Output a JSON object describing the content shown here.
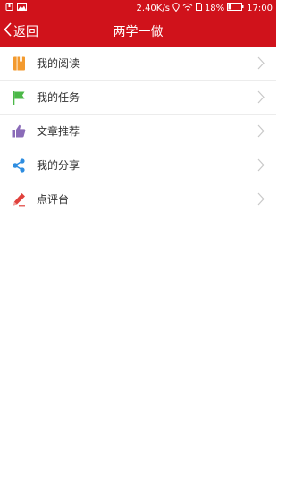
{
  "status_bar": {
    "net_speed": "2.40K/s",
    "battery_percent": "18%",
    "time": "17:00",
    "icons": [
      "notification-icon",
      "image-icon",
      "location-icon",
      "wifi-icon",
      "sim-icon",
      "battery-icon"
    ]
  },
  "nav": {
    "back_label": "返回",
    "title": "两学一做",
    "color": "#d0121b"
  },
  "menu": {
    "items": [
      {
        "label": "我的阅读",
        "icon": "book-icon",
        "color": "#f39a2e"
      },
      {
        "label": "我的任务",
        "icon": "flag-icon",
        "color": "#4cb848"
      },
      {
        "label": "文章推荐",
        "icon": "thumbs-up-icon",
        "color": "#8a6bb8"
      },
      {
        "label": "我的分享",
        "icon": "share-icon",
        "color": "#2e8de0"
      },
      {
        "label": "点评台",
        "icon": "pen-icon",
        "color": "#e0413c"
      }
    ]
  }
}
